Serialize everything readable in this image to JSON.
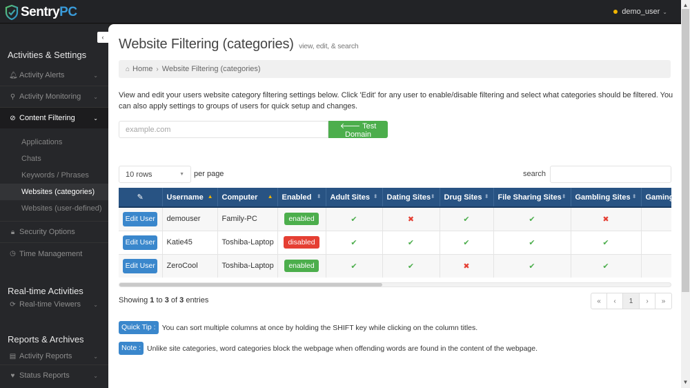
{
  "app": {
    "logo_text_main": "Sentry",
    "logo_text_accent": "PC",
    "user_name": "demo_user",
    "status_color": "#f0b400"
  },
  "sidebar": {
    "sections": [
      {
        "title": "Activities & Settings",
        "items": [
          {
            "label": "Activity Alerts",
            "icon": "bell-icon"
          },
          {
            "label": "Activity Monitoring",
            "icon": "search-icon"
          },
          {
            "label": "Content Filtering",
            "icon": "ban-icon",
            "active": true,
            "children": [
              {
                "label": "Applications"
              },
              {
                "label": "Chats"
              },
              {
                "label": "Keywords / Phrases"
              },
              {
                "label": "Websites (categories)",
                "active": true
              },
              {
                "label": "Websites (user-defined)"
              }
            ]
          },
          {
            "label": "Security Options",
            "icon": "lock-icon"
          },
          {
            "label": "Time Management",
            "icon": "clock-icon"
          }
        ]
      },
      {
        "title": "Real-time Activities",
        "items": [
          {
            "label": "Real-time Viewers",
            "icon": "refresh-icon"
          }
        ]
      },
      {
        "title": "Reports & Archives",
        "items": [
          {
            "label": "Activity Reports",
            "icon": "report-icon"
          },
          {
            "label": "Status Reports",
            "icon": "heartbeat-icon"
          }
        ]
      }
    ]
  },
  "main": {
    "title": "Website Filtering (categories)",
    "subtitle": "view, edit, & search",
    "breadcrumb": {
      "home": "Home",
      "current": "Website Filtering (categories)"
    },
    "intro": "View and edit your users website category filtering settings below.  Click 'Edit' for any user to enable/disable filtering and select what categories should be filtered.  You can also apply settings to groups of users for quick setup and changes.",
    "domain_placeholder": "example.com",
    "test_domain_label": "Test Domain",
    "rows_select": "10 rows",
    "per_page_label": "per page",
    "search_label": "search",
    "search_value": "",
    "table": {
      "columns": [
        "",
        "Username",
        "Computer",
        "Enabled",
        "Adult Sites",
        "Dating Sites",
        "Drug Sites",
        "File Sharing Sites",
        "Gambling Sites",
        "Gaming"
      ],
      "sort": [
        "none",
        "asc",
        "asc",
        "both",
        "both",
        "both",
        "both",
        "both",
        "both",
        "both"
      ],
      "edit_label": "Edit User",
      "rows": [
        {
          "username": "demouser",
          "computer": "Family-PC",
          "enabled": "enabled",
          "adult": true,
          "dating": false,
          "drug": true,
          "file_sharing": true,
          "gambling": false
        },
        {
          "username": "Katie45",
          "computer": "Toshiba-Laptop",
          "enabled": "disabled",
          "adult": true,
          "dating": true,
          "drug": true,
          "file_sharing": true,
          "gambling": true
        },
        {
          "username": "ZeroCool",
          "computer": "Toshiba-Laptop",
          "enabled": "enabled",
          "adult": true,
          "dating": true,
          "drug": false,
          "file_sharing": true,
          "gambling": true
        }
      ]
    },
    "showing": {
      "prefix": "Showing",
      "from": "1",
      "to_word": "to",
      "to": "3",
      "of_word": "of",
      "total": "3",
      "suffix": "entries"
    },
    "pager": {
      "first": "«",
      "prev": "‹",
      "current": "1",
      "next": "›",
      "last": "»"
    },
    "quick_tip": {
      "label": "Quick Tip :",
      "text": "You can sort multiple columns at once by holding the SHIFT key while clicking on the column titles."
    },
    "note": {
      "label": "Note :",
      "text": "Unlike site categories, word categories block the webpage when offending words are found in the content of the webpage."
    }
  }
}
